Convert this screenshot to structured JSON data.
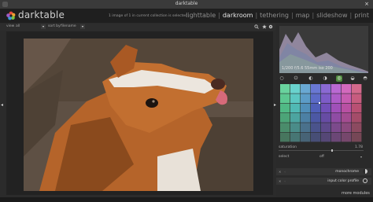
{
  "window": {
    "title": "darktable",
    "close": "×"
  },
  "app": {
    "name": "darktable",
    "collection_info": "1 image of 1 in current collection is selected"
  },
  "views": {
    "items": [
      "lighttable",
      "darkroom",
      "tethering",
      "map",
      "slideshow",
      "print"
    ],
    "separator": "|",
    "active": "darkroom"
  },
  "filterbar": {
    "view_label": "view",
    "view_value": "all",
    "sort_label": "sort by",
    "sort_value": "filename",
    "arrow": "▾"
  },
  "toolbar_icons": [
    "search-icon",
    "star-icon",
    "gear-icon"
  ],
  "histogram": {
    "info": "1/200 f/5.6 55mm iso 200"
  },
  "module_group_icons": [
    "circle-icon",
    "power-icon",
    "half-circle-icon",
    "color-wheel-icon",
    "palette-icon",
    "sliders-icon",
    "circle-half-icon"
  ],
  "color_mapping": {
    "saturation_label": "saturation",
    "saturation_value": "1.78",
    "saturation_level": 0.62,
    "select_label": "select",
    "select_value": "off"
  },
  "modules": [
    {
      "name": "monochrome",
      "icon_color": "#cfcfcf"
    },
    {
      "name": "input color profile",
      "icon_color": "#cfcfcf"
    }
  ],
  "more_modules_label": "more modules",
  "left_arrow": "◂",
  "right_arrow": "▸",
  "colors": {
    "accent": "#4f8a3e",
    "dog_fur": "#b5642a",
    "background": "#2b2b2b"
  }
}
